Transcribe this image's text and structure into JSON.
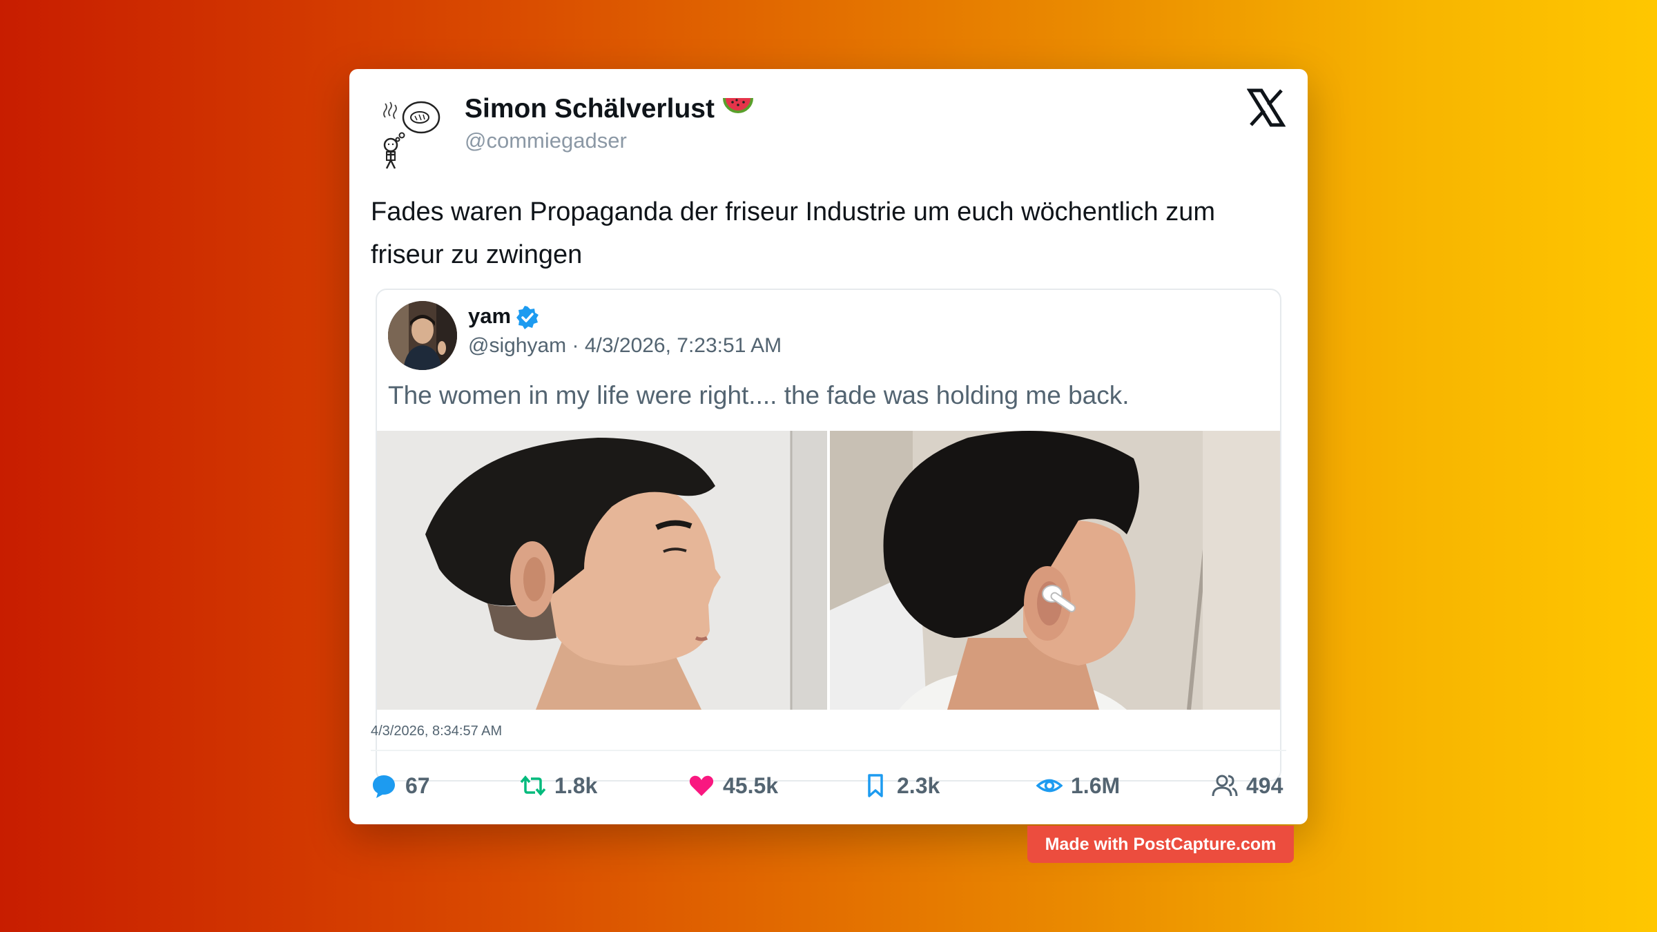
{
  "post": {
    "author_name": "Simon Schälverlust",
    "author_emoji": "watermelon-emoji",
    "author_handle": "@commiegadser",
    "text": "Fades waren Propaganda der friseur Industrie um euch wöchentlich zum friseur zu zwingen",
    "timestamp": "4/3/2026, 8:34:57 AM",
    "platform_icon": "x-logo-icon"
  },
  "quote": {
    "name": "yam",
    "verified": true,
    "handle": "@sighyam",
    "separator": " · ",
    "date": "4/3/2026, 7:23:51 AM",
    "text": "The women in my life were right.... the fade was holding me back.",
    "images": [
      "side-profile-photo",
      "back-of-head-photo"
    ]
  },
  "stats": {
    "replies": "67",
    "reposts": "1.8k",
    "likes": "45.5k",
    "bookmarks": "2.3k",
    "views": "1.6M",
    "followers": "494"
  },
  "colors": {
    "reply": "#1d9bf0",
    "repost": "#00ba7c",
    "like": "#f91880",
    "bookmark": "#1d9bf0",
    "views": "#1d9bf0",
    "followers": "#536471",
    "badge": "#ec4d3e",
    "gradient_start": "#c81d00",
    "gradient_end": "#ffc700"
  },
  "badge": {
    "label": "Made with PostCapture.com"
  }
}
